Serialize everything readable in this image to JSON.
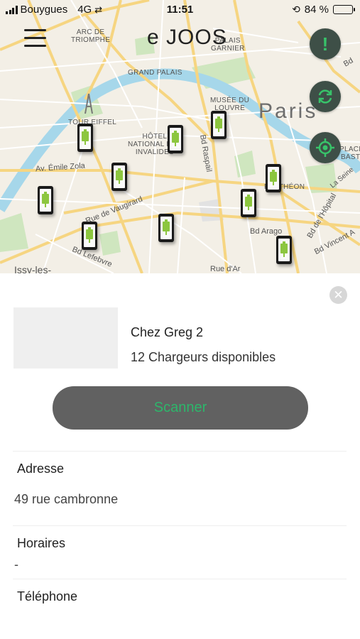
{
  "status_bar": {
    "carrier": "Bouygues",
    "network": "4G",
    "time": "11:51",
    "battery": "84 %",
    "battery_level": 0.84
  },
  "map": {
    "logo": "e JOOS",
    "city": "Paris",
    "labels": {
      "arc": "ARC DE\nTRIOMPHE",
      "palais_garnier": "PALAIS\nGARNIER",
      "grand_palais": "GRAND PALAIS",
      "musee_louvre": "MUSÉE DU\nLOUVRE",
      "tour_eiffel": "TOUR EIFFEL",
      "invalides": "HÔTEL\nNATIONAL DES\nINVALIDES",
      "pantheon": "PANTHÉON",
      "place_bastille": "PLACE\nBASTI"
    },
    "streets": {
      "emile_zola": "Av. Émile Zola",
      "vaugirard": "Rue de Vaugirard",
      "raspail": "Bd Raspail",
      "lefebvre": "Bd Lefebvre",
      "arago": "Bd Arago",
      "hopital": "Bd de l'Hôpital",
      "vincent": "Bd Vincent A",
      "rue_arago": "Rue d'Ar",
      "issy": "Issy-les-",
      "seine": "La Seine",
      "bd_edge": "Bd"
    },
    "alert_symbol": "!",
    "colors": {
      "fab_bg": "#3e4f47",
      "accent_green": "#38c36a",
      "charger_battery": "#8cc63f"
    }
  },
  "place": {
    "name": "Chez Greg 2",
    "chargers": "12 Chargeurs disponibles",
    "close_symbol": "✕",
    "scan_label": "Scanner",
    "address_label": "Adresse",
    "address_value": "49 rue cambronne",
    "hours_label": "Horaires",
    "hours_value": "-",
    "phone_label": "Téléphone"
  }
}
